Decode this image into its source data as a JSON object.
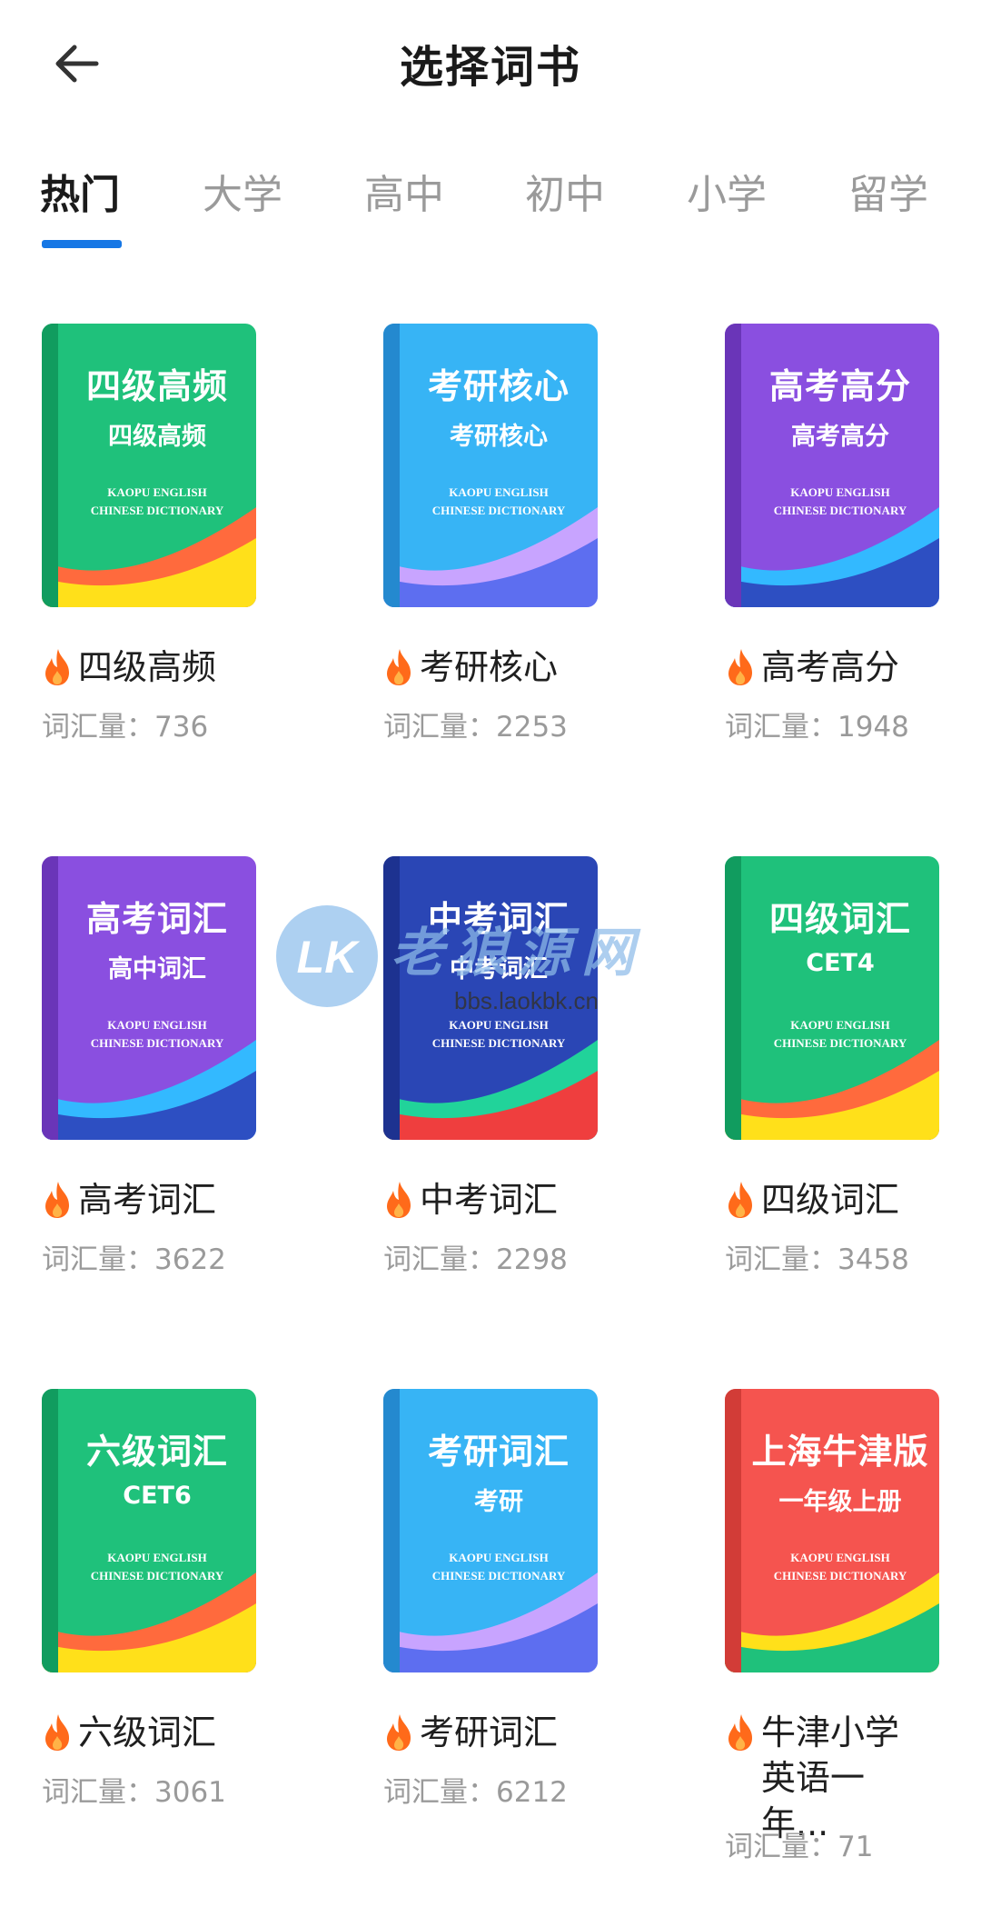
{
  "header": {
    "title": "选择词书"
  },
  "tabs": [
    "热门",
    "大学",
    "高中",
    "初中",
    "小学",
    "留学"
  ],
  "active_tab": 0,
  "count_label": "词汇量：",
  "books": [
    {
      "cover_title": "四级高频",
      "cover_sub": "四级高频",
      "name": "四级高频",
      "count": "736",
      "cover_color": "#1fc17b",
      "spine_color": "#119c5f",
      "wave_top": "#ff6a3d",
      "wave_bottom": "#ffe01a",
      "cover_en": "KAOPU ENGLISH\nCHINESE DICTIONARY"
    },
    {
      "cover_title": "考研核心",
      "cover_sub": "考研核心",
      "name": "考研核心",
      "count": "2253",
      "cover_color": "#37b4f5",
      "spine_color": "#2489cf",
      "wave_top": "#c8a4ff",
      "wave_bottom": "#5d6ef0",
      "cover_en": "KAOPU ENGLISH\nCHINESE DICTIONARY"
    },
    {
      "cover_title": "高考高分",
      "cover_sub": "高考高分",
      "name": "高考高分",
      "count": "1948",
      "cover_color": "#8a4fe0",
      "spine_color": "#6a35b8",
      "wave_top": "#33b9ff",
      "wave_bottom": "#2d4fc2",
      "cover_en": "KAOPU ENGLISH\nCHINESE DICTIONARY"
    },
    {
      "cover_title": "高考词汇",
      "cover_sub": "高中词汇",
      "name": "高考词汇",
      "count": "3622",
      "cover_color": "#8a4fe0",
      "spine_color": "#6a35b8",
      "wave_top": "#33b9ff",
      "wave_bottom": "#2d4fc2",
      "cover_en": "KAOPU ENGLISH\nCHINESE DICTIONARY"
    },
    {
      "cover_title": "中考词汇",
      "cover_sub": "中考词汇",
      "name": "中考词汇",
      "count": "2298",
      "cover_color": "#2a46b5",
      "spine_color": "#1d3290",
      "wave_top": "#21d39a",
      "wave_bottom": "#ef3e3e",
      "cover_en": "KAOPU ENGLISH\nCHINESE DICTIONARY"
    },
    {
      "cover_title": "四级词汇",
      "cover_sub": "CET4",
      "name": "四级词汇",
      "count": "3458",
      "cover_color": "#1fc17b",
      "spine_color": "#119c5f",
      "wave_top": "#ff6a3d",
      "wave_bottom": "#ffe01a",
      "cover_en": "KAOPU ENGLISH\nCHINESE DICTIONARY"
    },
    {
      "cover_title": "六级词汇",
      "cover_sub": "CET6",
      "name": "六级词汇",
      "count": "3061",
      "cover_color": "#1fc17b",
      "spine_color": "#119c5f",
      "wave_top": "#ff6a3d",
      "wave_bottom": "#ffe01a",
      "cover_en": "KAOPU ENGLISH\nCHINESE DICTIONARY"
    },
    {
      "cover_title": "考研词汇",
      "cover_sub": "考研",
      "name": "考研词汇",
      "count": "6212",
      "cover_color": "#37b4f5",
      "spine_color": "#2489cf",
      "wave_top": "#c8a4ff",
      "wave_bottom": "#5d6ef0",
      "cover_en": "KAOPU ENGLISH\nCHINESE DICTIONARY"
    },
    {
      "cover_title": "上海牛津版",
      "cover_sub": "一年级上册",
      "name": "牛津小学英语一年...",
      "count": "71",
      "cover_color": "#f5544f",
      "spine_color": "#d23c37",
      "wave_top": "#ffe01a",
      "wave_bottom": "#1fc17b",
      "cover_en": "KAOPU ENGLISH\nCHINESE DICTIONARY"
    }
  ],
  "watermark": {
    "logo": "LK",
    "text": "老狼源网",
    "url": "bbs.laokbk.cn"
  }
}
